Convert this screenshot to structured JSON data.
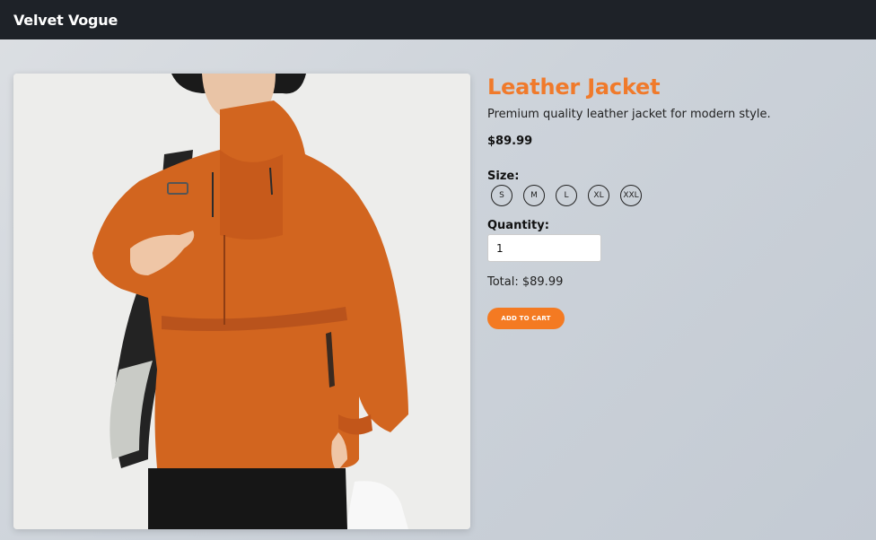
{
  "header": {
    "brand": "Velvet Vogue"
  },
  "product": {
    "image_alt": "Orange hooded anorak jacket worn by model",
    "title": "Leather Jacket",
    "description": "Premium quality leather jacket for modern style.",
    "price": "$89.99",
    "size_label": "Size:",
    "sizes": [
      "S",
      "M",
      "L",
      "XL",
      "XXL"
    ],
    "quantity_label": "Quantity:",
    "quantity_value": "1",
    "total": "Total: $89.99",
    "add_to_cart": "ADD TO CART"
  },
  "colors": {
    "accent": "#f47a22",
    "header_bg": "#1e2228",
    "jacket": "#d2651f"
  }
}
